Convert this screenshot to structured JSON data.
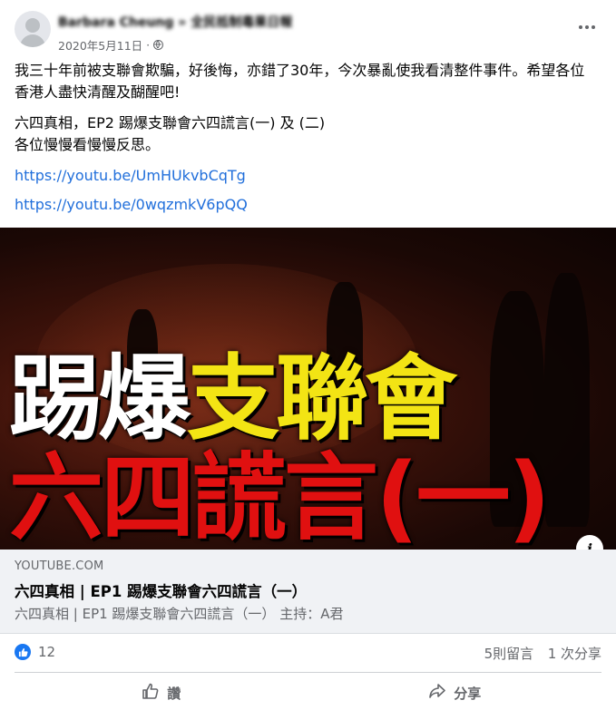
{
  "post": {
    "author": "Barbara Cheung » 全民抵制毒果日報",
    "date": "2020年5月11日",
    "dot": "·",
    "paragraph1": "我三十年前被支聯會欺騙，好後悔，亦錯了30年，今次暴亂使我看清整件事件。希望各位香港人盡快清醒及醐醒吧!",
    "paragraph2_line1": "六四真相，EP2 踢爆支聯會六四謊言(一) 及 (二)",
    "paragraph2_line2": "各位慢慢看慢慢反思。",
    "link1": "https://youtu.be/UmHUkvbCqTg",
    "link2": "https://youtu.be/0wqzmkV6pQQ"
  },
  "thumbnail": {
    "line1_white": "踢爆",
    "line1_yellow": "支聯會",
    "line2_red": "六四謊言(一)",
    "info_glyph": "i",
    "colors": {
      "white": "#ffffff",
      "yellow": "#f3e414",
      "red": "#e01010"
    }
  },
  "link_preview": {
    "domain": "YOUTUBE.COM",
    "title": "六四真相 | EP1 踢爆支聯會六四謊言（一）",
    "description": "六四真相 | EP1 踢爆支聯會六四謊言（一） 主持：A君"
  },
  "stats": {
    "like_count": "12",
    "comments": "5則留言",
    "shares": "1 次分享"
  },
  "actions": {
    "like_label": "讚",
    "share_label": "分享"
  },
  "icons": {
    "avatar": "default-avatar-icon",
    "privacy": "globe-icon",
    "more": "more-options-icon",
    "like_badge": "like-reaction-icon",
    "like_action": "thumbs-up-icon",
    "share_action": "share-arrow-icon",
    "info": "info-icon"
  },
  "colors": {
    "link": "#216fdb",
    "like_blue": "#1877f2",
    "secondary_text": "#65676b"
  }
}
